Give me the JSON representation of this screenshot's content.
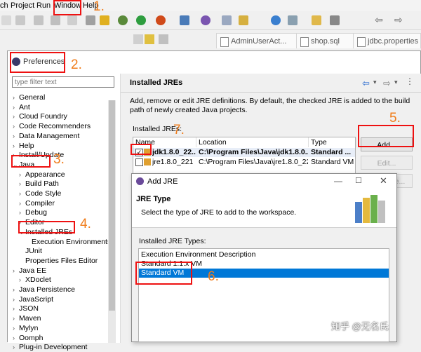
{
  "ide": {
    "menu": [
      "ch",
      "Project",
      "Run",
      "Window",
      "Help"
    ],
    "editor_tabs": [
      "AdminUserAct...",
      "shop.sql",
      "jdbc.properties"
    ]
  },
  "preferences": {
    "title": "Preferences",
    "filter_placeholder": "type filter text",
    "tree": [
      {
        "label": "General",
        "arrow": "›"
      },
      {
        "label": "Ant",
        "arrow": "›"
      },
      {
        "label": "Cloud Foundry",
        "arrow": "›"
      },
      {
        "label": "Code Recommenders",
        "arrow": "›"
      },
      {
        "label": "Data Management",
        "arrow": "›"
      },
      {
        "label": "Help",
        "arrow": "›"
      },
      {
        "label": "Install/Update",
        "arrow": "›"
      },
      {
        "label": "Java",
        "arrow": "⌄"
      },
      {
        "label": "Appearance",
        "arrow": "›"
      },
      {
        "label": "Build Path",
        "arrow": "›"
      },
      {
        "label": "Code Style",
        "arrow": "›"
      },
      {
        "label": "Compiler",
        "arrow": "›"
      },
      {
        "label": "Debug",
        "arrow": "›"
      },
      {
        "label": "Editor",
        "arrow": "›"
      },
      {
        "label": "Installed JREs",
        "arrow": "⌄"
      },
      {
        "label": "Execution Environments",
        "arrow": ""
      },
      {
        "label": "JUnit",
        "arrow": ""
      },
      {
        "label": "Properties Files Editor",
        "arrow": ""
      },
      {
        "label": "Java EE",
        "arrow": "›"
      },
      {
        "label": "XDoclet",
        "arrow": "›"
      },
      {
        "label": "Java Persistence",
        "arrow": "›"
      },
      {
        "label": "JavaScript",
        "arrow": "›"
      },
      {
        "label": "JSON",
        "arrow": "›"
      },
      {
        "label": "Maven",
        "arrow": "›"
      },
      {
        "label": "Mylyn",
        "arrow": "›"
      },
      {
        "label": "Oomph",
        "arrow": "›"
      },
      {
        "label": "Plug-in Development",
        "arrow": "›"
      }
    ],
    "page_title": "Installed JREs",
    "description": "Add, remove or edit JRE definitions. By default, the checked JRE is added to the build path of newly created Java projects.",
    "table_label": "Installed JREs:",
    "columns": [
      "Name",
      "Location",
      "Type"
    ],
    "rows": [
      {
        "name": "jdk1.8.0_22...",
        "location": "C:\\Program Files\\Java\\jdk1.8.0...",
        "type": "Standard ...",
        "checked": true
      },
      {
        "name": "jre1.8.0_221",
        "location": "C:\\Program Files\\Java\\jre1.8.0_221",
        "type": "Standard VM",
        "checked": false
      }
    ],
    "buttons": {
      "add": "Add...",
      "edit": "Edit...",
      "duplicate": "Duplicate..."
    }
  },
  "add_jre": {
    "title": "Add JRE",
    "header": "JRE Type",
    "subheader": "Select the type of JRE to add to the workspace.",
    "list_label": "Installed JRE Types:",
    "types": [
      "Execution Environment Description",
      "Standard 1.1.x VM",
      "Standard VM"
    ],
    "selected": "Standard VM"
  },
  "annotations": [
    "1.",
    "2.",
    "3.",
    "4.",
    "5.",
    "6.",
    "7."
  ],
  "watermark": "知乎 @无名氏",
  "colors": {
    "accent": "#0078d7",
    "annotation_box": "#ee1111",
    "annotation_text": "#f07c1a"
  }
}
